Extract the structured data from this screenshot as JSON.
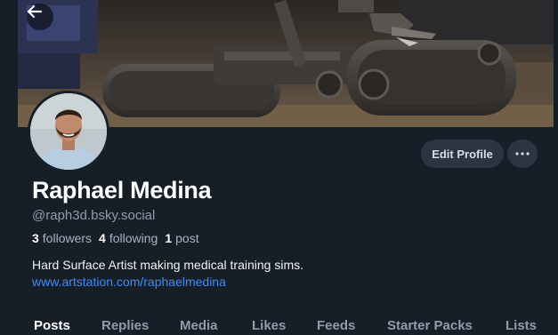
{
  "header": {
    "back_icon": "arrow-left-icon",
    "more_icon": "ellipsis-icon"
  },
  "profile": {
    "display_name": "Raphael Medina",
    "handle": "@raph3d.bsky.social",
    "followers_count": "3",
    "followers_label": "followers",
    "following_count": "4",
    "following_label": "following",
    "posts_count": "1",
    "posts_label": "post",
    "bio": "Hard Surface Artist making medical training sims.",
    "link": "www.artstation.com/raphaelmedina",
    "edit_button_label": "Edit Profile"
  },
  "tabs": [
    {
      "label": "Posts",
      "active": true
    },
    {
      "label": "Replies",
      "active": false
    },
    {
      "label": "Media",
      "active": false
    },
    {
      "label": "Likes",
      "active": false
    },
    {
      "label": "Feeds",
      "active": false
    },
    {
      "label": "Starter Packs",
      "active": false
    },
    {
      "label": "Lists",
      "active": false
    }
  ],
  "colors": {
    "background": "#161e28",
    "button": "#2a3443",
    "link": "#3e8bf5",
    "muted_text": "#8f9cac"
  }
}
